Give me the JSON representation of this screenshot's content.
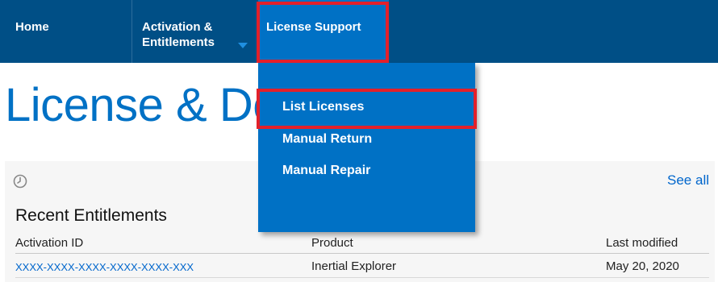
{
  "nav": {
    "home": "Home",
    "activation_line1": "Activation &",
    "activation_line2": "Entitlements",
    "license_support": "License Support"
  },
  "page": {
    "title": "License & Del"
  },
  "dropdown": {
    "items": [
      {
        "label": "List Licenses"
      },
      {
        "label": "Manual Return"
      },
      {
        "label": "Manual Repair"
      }
    ]
  },
  "recent": {
    "see_all": "See all",
    "title": "Recent Entitlements",
    "columns": [
      "Activation ID",
      "Product",
      "Last modified"
    ],
    "rows": [
      {
        "activation_id": "XXXX-XXXX-XXXX-XXXX-XXXX-XXX",
        "product": "Inertial Explorer",
        "last_modified": "May 20, 2020"
      }
    ]
  },
  "colors": {
    "nav_bg": "#004f86",
    "menu_bg": "#0071c5",
    "highlight": "#e3202a",
    "link": "#0066cc"
  },
  "icons": [
    "clock-icon",
    "chevron-down-icon"
  ]
}
